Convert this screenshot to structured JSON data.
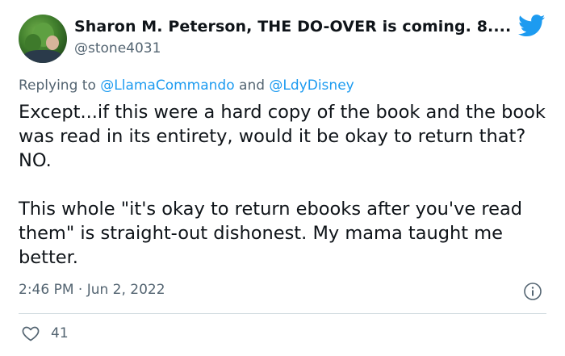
{
  "author": {
    "name": "Sharon M. Peterson, THE DO-OVER is coming. 8....",
    "handle": "@stone4031",
    "avatar_icon": "avatar-photo"
  },
  "platform_icon": "twitter-bird-icon",
  "reply": {
    "prefix": "Replying to ",
    "mentions": [
      "@LlamaCommando",
      "@LdyDisney"
    ],
    "joiner": " and "
  },
  "body": {
    "paragraph1": "Except...if this were a hard copy of the book and the book was read in its entirety, would it be okay to return that? NO.",
    "paragraph2": "This whole \"it's okay to return ebooks after you've read them\" is straight-out dishonest. My mama taught me better."
  },
  "timestamp": "2:46 PM · Jun 2, 2022",
  "likes": {
    "count": "41",
    "icon": "heart-icon"
  },
  "colors": {
    "accent": "#1d9bf0",
    "text": "#0f1419",
    "muted": "#536471",
    "divider": "#cfd9de"
  }
}
